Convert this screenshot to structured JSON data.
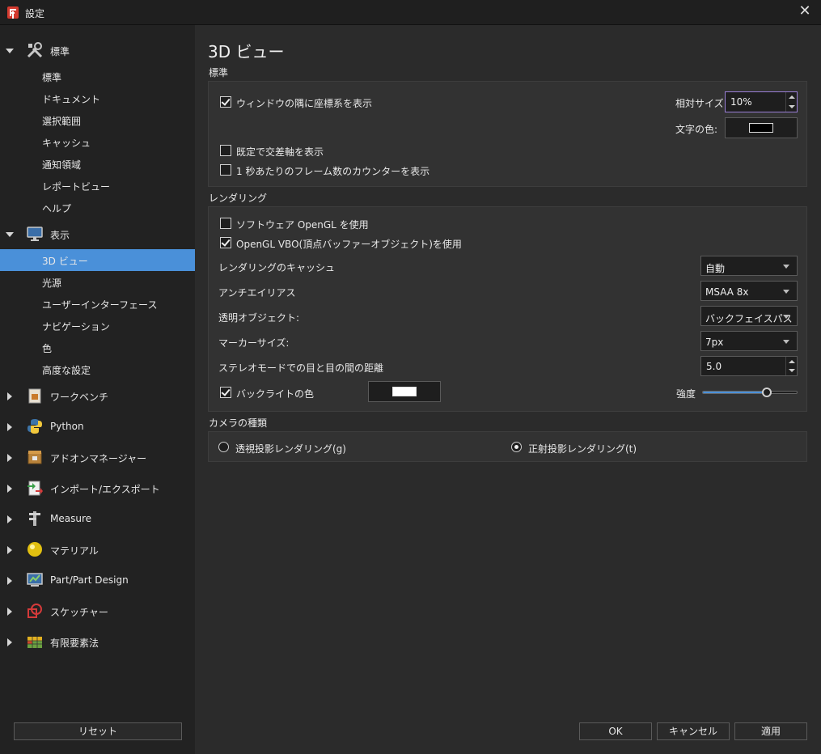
{
  "window": {
    "title": "設定"
  },
  "sidebar": {
    "categories": [
      {
        "label": "標準",
        "icon": "tools-icon",
        "expanded": true,
        "items": [
          "標準",
          "ドキュメント",
          "選択範囲",
          "キャッシュ",
          "通知領域",
          "レポートビュー",
          "ヘルプ"
        ]
      },
      {
        "label": "表示",
        "icon": "monitor-icon",
        "expanded": true,
        "items": [
          "3D ビュー",
          "光源",
          "ユーザーインターフェース",
          "ナビゲーション",
          "色",
          "高度な設定"
        ],
        "selected": "3D ビュー"
      },
      {
        "label": "ワークベンチ",
        "icon": "workbench-icon",
        "expanded": false
      },
      {
        "label": "Python",
        "icon": "python-icon",
        "expanded": false
      },
      {
        "label": "アドオンマネージャー",
        "icon": "addon-manager-icon",
        "expanded": false
      },
      {
        "label": "インポート/エクスポート",
        "icon": "import-export-icon",
        "expanded": false
      },
      {
        "label": "Measure",
        "icon": "measure-icon",
        "expanded": false
      },
      {
        "label": "マテリアル",
        "icon": "material-icon",
        "expanded": false
      },
      {
        "label": "Part/Part Design",
        "icon": "part-design-icon",
        "expanded": false
      },
      {
        "label": "スケッチャー",
        "icon": "sketcher-icon",
        "expanded": false
      },
      {
        "label": "有限要素法",
        "icon": "fem-icon",
        "expanded": false
      }
    ],
    "reset_label": "リセット"
  },
  "main": {
    "page_title": "3D ビュー",
    "general": {
      "section_label": "標準",
      "show_axis_cross": {
        "label": "ウィンドウの隅に座標系を表示",
        "checked": true
      },
      "relative_size_label": "相対サイズ:",
      "relative_size_value": "10%",
      "text_color_label": "文字の色:",
      "text_color": "#000000",
      "show_axis_default": {
        "label": "既定で交差軸を表示",
        "checked": false
      },
      "show_fps": {
        "label": "1 秒あたりのフレーム数のカウンターを表示",
        "checked": false
      }
    },
    "rendering": {
      "section_label": "レンダリング",
      "software_opengl": {
        "label": "ソフトウェア OpenGL を使用",
        "checked": false
      },
      "opengl_vbo": {
        "label": "OpenGL VBO(頂点バッファーオブジェクト)を使用",
        "checked": true
      },
      "render_cache_label": "レンダリングのキャッシュ",
      "render_cache_value": "自動",
      "antialiasing_label": "アンチエイリアス",
      "antialiasing_value": "MSAA 8x",
      "transparent_label": "透明オブジェクト:",
      "transparent_value": "バックフェイスパス",
      "marker_size_label": "マーカーサイズ:",
      "marker_size_value": "7px",
      "eye_distance_label": "ステレオモードでの目と目の間の距離",
      "eye_distance_value": "5.0",
      "backlight": {
        "label": "バックライトの色",
        "checked": true
      },
      "backlight_color": "#ffffff",
      "intensity_label": "強度",
      "intensity_fraction": 0.68
    },
    "camera": {
      "section_label": "カメラの種類",
      "perspective_label": "透視投影レンダリング(g)",
      "perspective_selected": false,
      "orthographic_label": "正射投影レンダリング(t)",
      "orthographic_selected": true
    }
  },
  "footer": {
    "ok_label": "OK",
    "cancel_label": "キャンセル",
    "apply_label": "適用"
  },
  "colors": {
    "accent": "#4a90d9",
    "background": "#2b2b2b",
    "sidebar": "#222222"
  }
}
